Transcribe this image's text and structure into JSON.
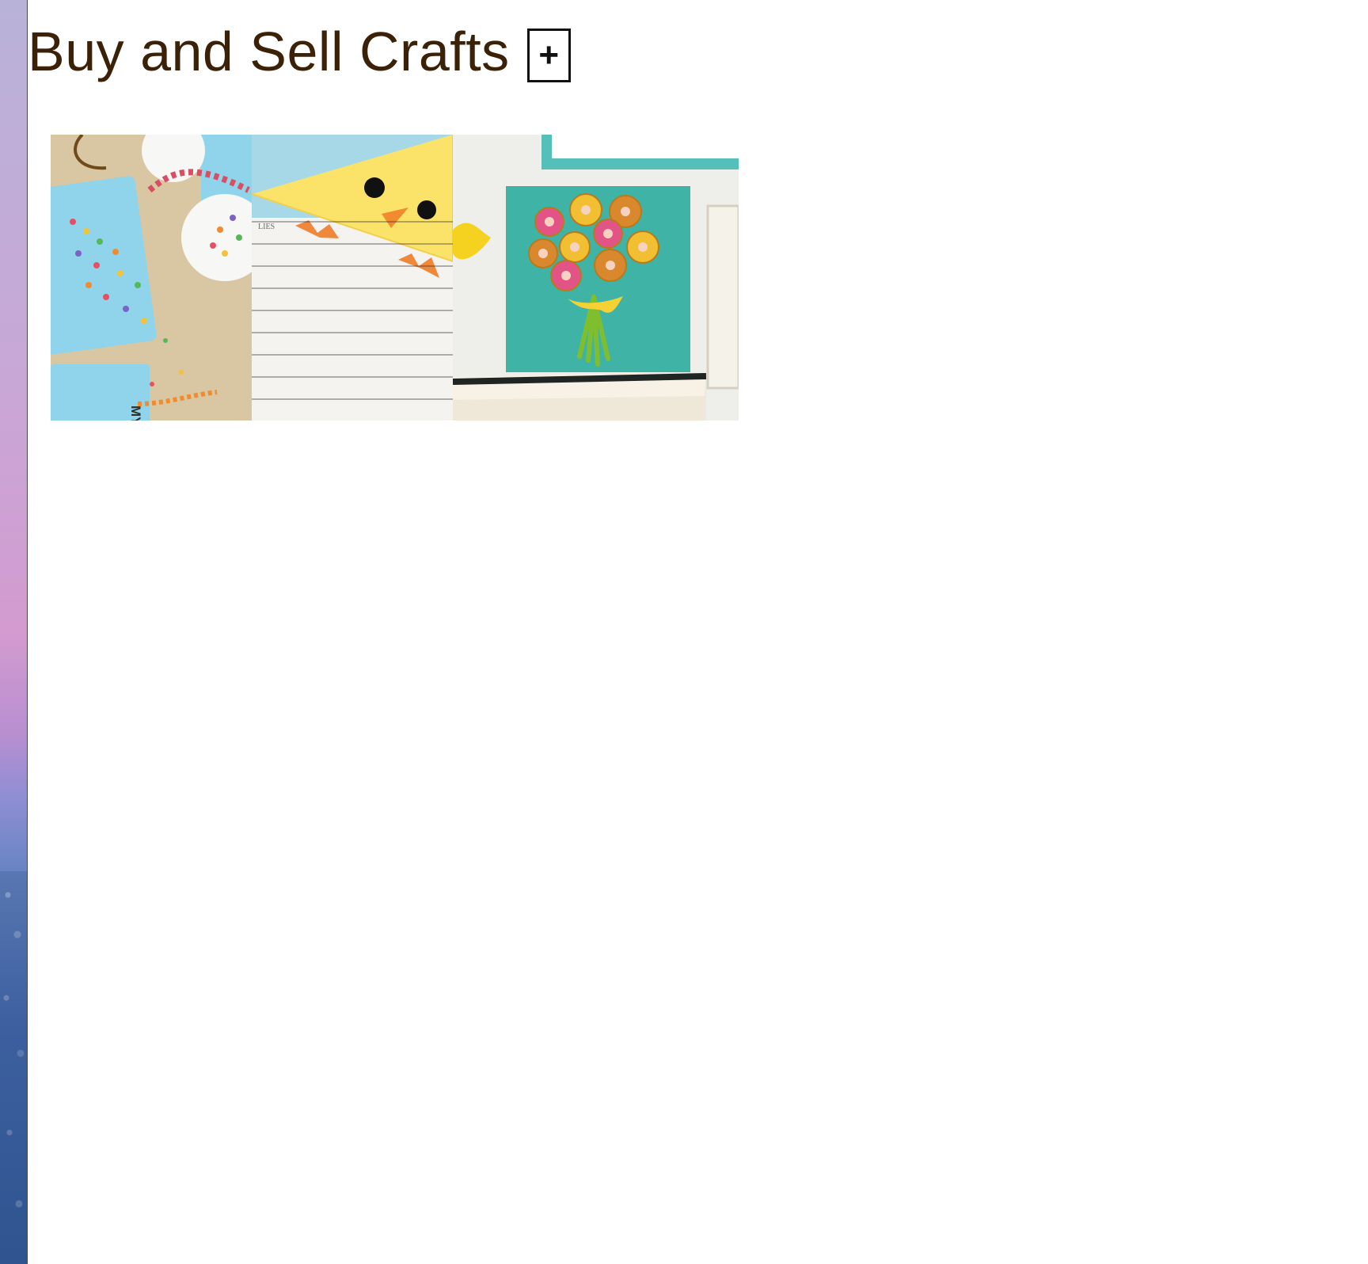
{
  "header": {
    "title": "Buy and Sell Crafts",
    "add_button_label": "+"
  },
  "gallery": {
    "items": [
      {
        "icon": "cereal-necklace-photo"
      },
      {
        "icon": "chick-bookmark-photo"
      },
      {
        "icon": "flower-canvas-photo"
      }
    ]
  }
}
